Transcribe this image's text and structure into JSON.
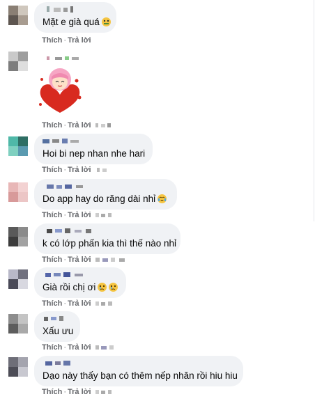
{
  "actions": {
    "like_label": "Thích",
    "reply_label": "Trả lời",
    "separator": "·"
  },
  "comments": [
    {
      "text": "Mặt e già quá",
      "emoji": "dizzy-face"
    },
    {
      "sticker": "pink-hair-girl-hugging-heart"
    },
    {
      "text": "Hoi bi nep nhan nhe hari"
    },
    {
      "text": "Do app hay do răng dài nhỉ",
      "emoji": "crying-laughing"
    },
    {
      "text": "k có lớp phấn kia thì thế nào nhỉ"
    },
    {
      "text": "Già rồi chị ơi",
      "emoji": "crying-face-x2"
    },
    {
      "text": "Xấu ưu"
    },
    {
      "text": "Dạo này thấy bạn có thêm nếp nhăn rồi hiu hiu"
    }
  ],
  "colors": {
    "bubble": "#f0f2f5",
    "meta": "#65676b",
    "text": "#050505"
  }
}
